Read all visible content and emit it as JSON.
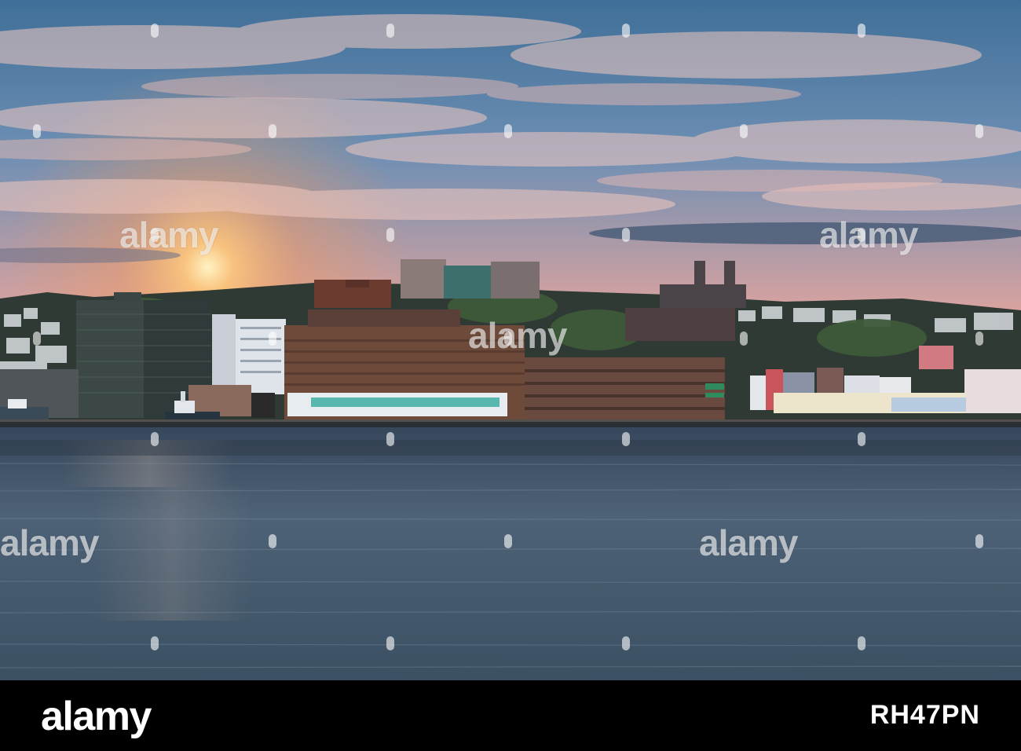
{
  "watermark": {
    "text": "alamy"
  },
  "footer": {
    "logo": "alamy",
    "image_id": "RH47PN"
  }
}
